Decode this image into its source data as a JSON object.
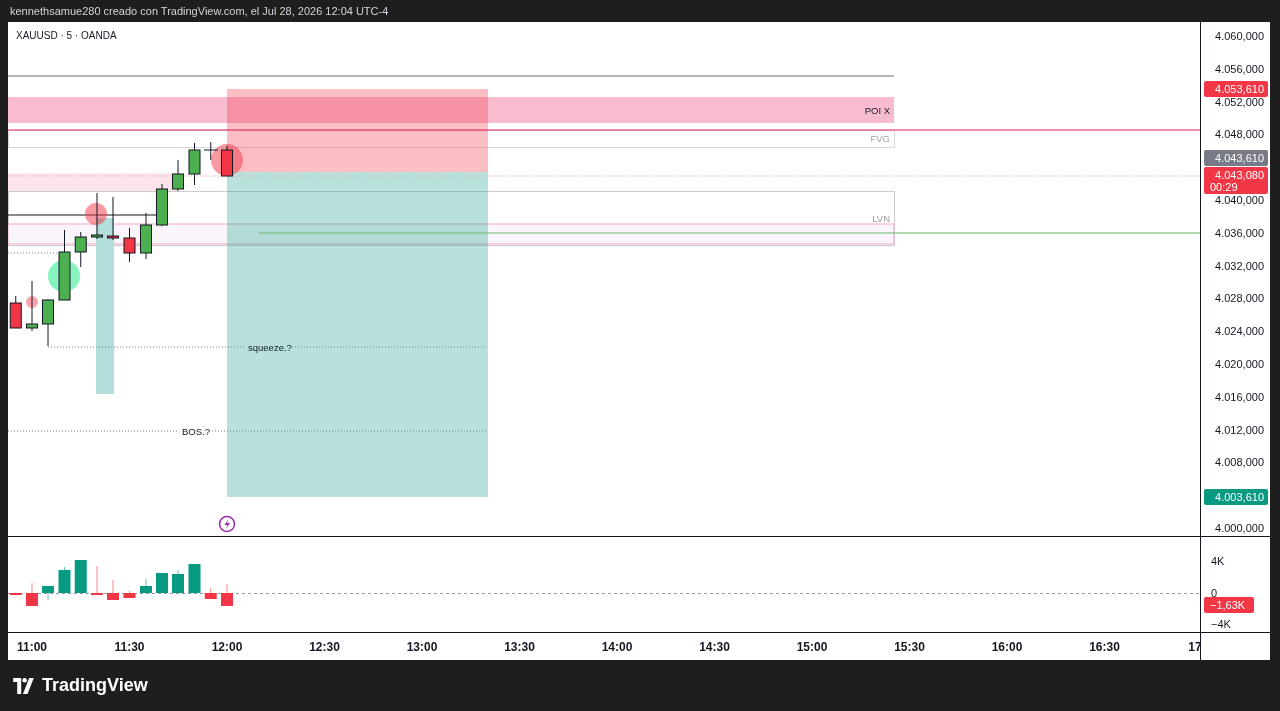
{
  "header": {
    "attribution": "kennethsamue280 creado con TradingView.com, el Jul 28, 2026 12:04 UTC-4"
  },
  "chart": {
    "symbol": "XAUUSD · 5 · OANDA",
    "annotations": [
      {
        "kind": "poi",
        "text": "POI X"
      },
      {
        "kind": "fvg",
        "text": "FVG"
      },
      {
        "kind": "lvn",
        "text": "LVN"
      },
      {
        "kind": "squeeze",
        "text": "squeeze.?"
      },
      {
        "kind": "bos",
        "text": "BOS.?"
      }
    ],
    "price_axis": {
      "labels": [
        "4.060,000",
        "4.056,000",
        "4.052,000",
        "4.048,000",
        "4.040,000",
        "4.036,000",
        "4.032,000",
        "4.028,000",
        "4.024,000",
        "4.020,000",
        "4.016,000",
        "4.012,000",
        "4.008,000",
        "4.000,000"
      ]
    },
    "price_badges": [
      {
        "kind": "target",
        "text": "4.053,610",
        "color": "#f23645"
      },
      {
        "kind": "entry",
        "text": "4.043,610",
        "color": "#787b86"
      },
      {
        "kind": "last",
        "text": "4.043,080",
        "timer": "00:29",
        "color": "#f23645"
      },
      {
        "kind": "stop",
        "text": "4.003,610",
        "color": "#089981"
      }
    ],
    "volume_axis": {
      "labels": [
        "4K",
        "0",
        "−4K"
      ]
    },
    "volume_badge": {
      "text": "−1,63K",
      "color": "#f23645"
    },
    "time_axis": {
      "labels": [
        "11:00",
        "11:30",
        "12:00",
        "12:30",
        "13:00",
        "13:30",
        "14:00",
        "14:30",
        "15:00",
        "15:30",
        "16:00",
        "16:30",
        "17"
      ]
    }
  },
  "footer": {
    "brand": "TradingView"
  }
}
